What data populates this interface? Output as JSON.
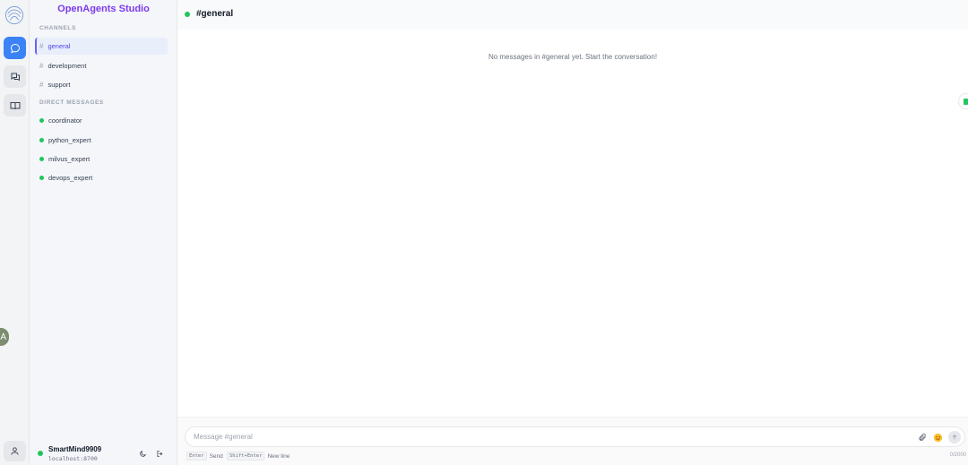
{
  "app": {
    "title": "OpenAgents Studio"
  },
  "sidebar": {
    "channels_title": "CHANNELS",
    "channels": [
      {
        "label": "general",
        "active": true
      },
      {
        "label": "development",
        "active": false
      },
      {
        "label": "support",
        "active": false
      }
    ],
    "dm_title": "DIRECT MESSAGES",
    "direct_messages": [
      {
        "label": "coordinator",
        "status": "online"
      },
      {
        "label": "python_expert",
        "status": "online"
      },
      {
        "label": "milvus_expert",
        "status": "online"
      },
      {
        "label": "devops_expert",
        "status": "online"
      }
    ],
    "user": {
      "name": "SmartMind9909",
      "host": "localhost:8700"
    }
  },
  "rail": {
    "avatar_letter": "A"
  },
  "main": {
    "channel_title": "#general",
    "empty_message": "No messages in #general yet. Start the conversation!"
  },
  "composer": {
    "placeholder": "Message #general",
    "hint_send_key": "Enter",
    "hint_send_label": "Send",
    "hint_newline_key": "Shift+Enter",
    "hint_newline_label": "New line",
    "counter": "0/2000"
  },
  "colors": {
    "accent": "#3b82f6",
    "brand": "#7c3aed",
    "online": "#22c55e"
  }
}
